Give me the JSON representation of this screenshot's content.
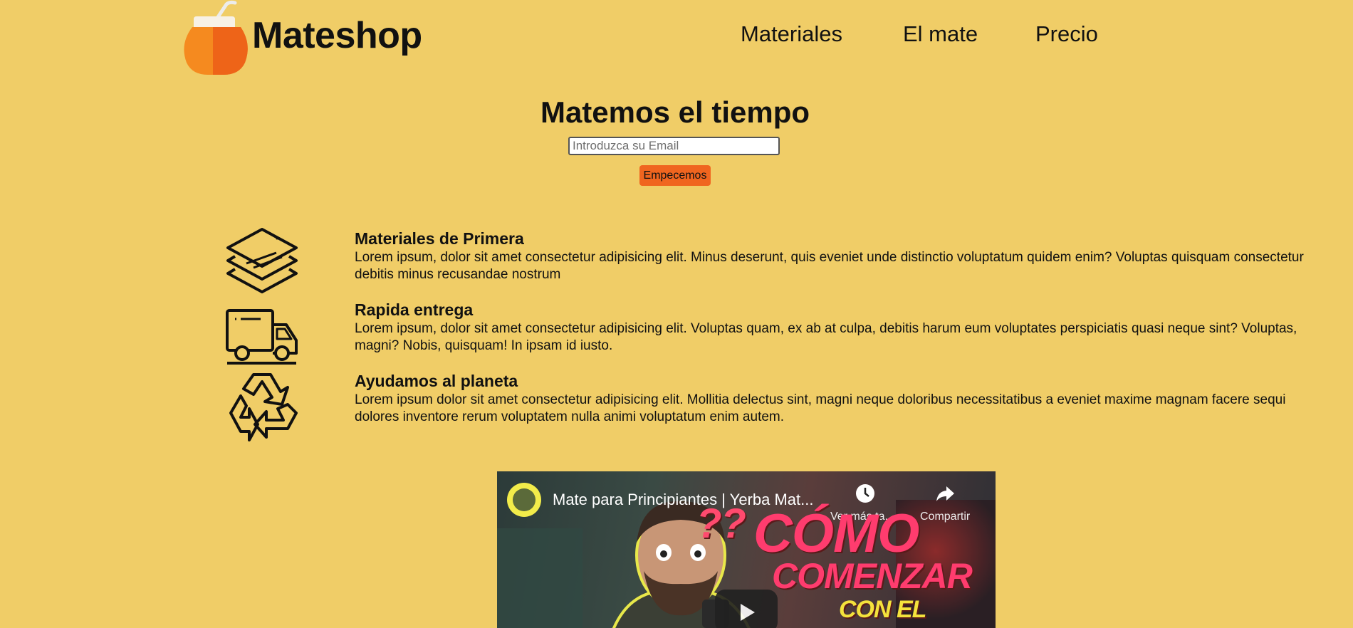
{
  "header": {
    "brand": "Mateshop",
    "nav": [
      {
        "label": "Materiales"
      },
      {
        "label": "El mate"
      },
      {
        "label": "Precio"
      }
    ]
  },
  "hero": {
    "title": "Matemos el tiempo",
    "email_placeholder": "Introduzca su Email",
    "email_value": "",
    "cta_label": "Empecemos"
  },
  "features": [
    {
      "icon": "layers-icon",
      "title": "Materiales de Primera",
      "description": "Lorem ipsum, dolor sit amet consectetur adipisicing elit. Minus deserunt, quis eveniet unde distinctio voluptatum quidem enim? Voluptas quisquam consectetur debitis minus recusandae nostrum"
    },
    {
      "icon": "delivery-truck-icon",
      "title": "Rapida entrega",
      "description": "Lorem ipsum, dolor sit amet consectetur adipisicing elit. Voluptas quam, ex ab at culpa, debitis harum eum voluptates perspiciatis quasi neque sint? Voluptas, magni? Nobis, quisquam! In ipsam id iusto."
    },
    {
      "icon": "recycle-icon",
      "title": "Ayudamos al planeta",
      "description": "Lorem ipsum dolor sit amet consectetur adipisicing elit. Mollitia delectus sint, magni neque doloribus necessitatibus a eveniet maxime magnam facere sequi dolores inventore rerum voluptatem nulla animi voluptatum enim autem."
    }
  ],
  "video": {
    "title": "Mate para Principiantes | Yerba Mat...",
    "watch_later_label": "Ver más ta...",
    "share_label": "Compartir",
    "thumbnail_text_line1": "CÓMO",
    "thumbnail_text_line2": "COMENZAR",
    "thumbnail_text_line3": "CON EL",
    "thumbnail_marks": "??"
  },
  "colors": {
    "background": "#f0cd67",
    "accent": "#f0651f",
    "gourd": "#f58220"
  }
}
